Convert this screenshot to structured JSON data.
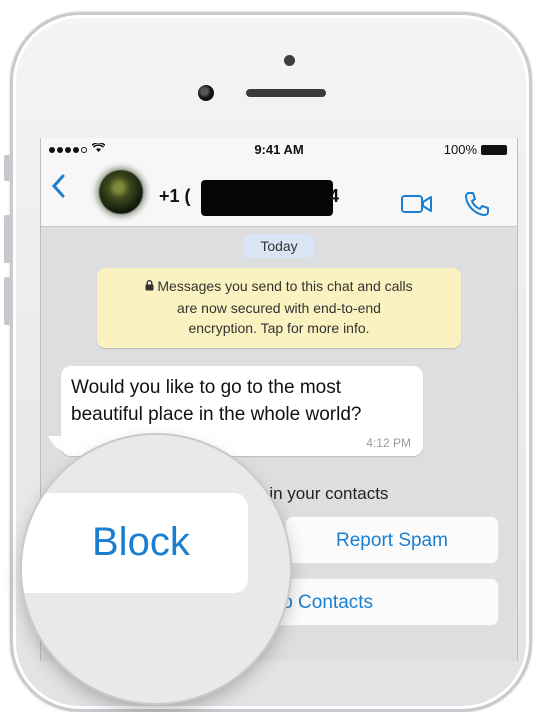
{
  "status_bar": {
    "time": "9:41 AM",
    "battery": "100%"
  },
  "chat_header": {
    "back_glyph": "‹",
    "contact_prefix": "+1 (",
    "contact_suffix": "4"
  },
  "date_badge": "Today",
  "encryption_notice": {
    "lines": [
      "Messages you send to this chat and calls",
      "are now secured with end-to-end",
      "encryption. Tap for more info."
    ]
  },
  "message": {
    "text": "Would you like to go to the most beautiful place in the whole world?",
    "time": "4:12 PM"
  },
  "contact_prompt": {
    "text": "not in your contacts"
  },
  "actions": {
    "block": "Block",
    "report_spam": "Report Spam",
    "add_to_contacts": "to Contacts"
  },
  "icons": {
    "video_call": "video-camera-icon",
    "voice_call": "phone-icon",
    "back": "chevron-left-icon",
    "lock": "lock-icon"
  },
  "colors": {
    "accent": "#1a7fd1",
    "notice_bg": "#fbf2c1",
    "chat_bg": "#dddedf"
  }
}
